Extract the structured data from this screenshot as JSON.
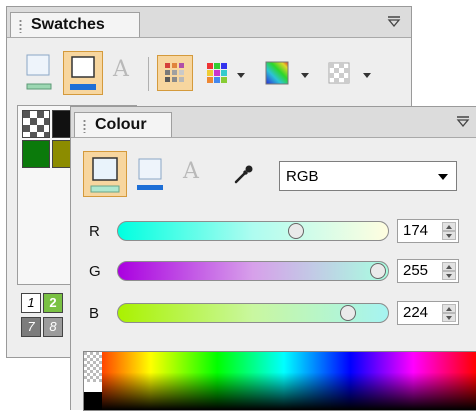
{
  "swatches_panel": {
    "title": "Swatches",
    "numbered_swatches": [
      "1",
      "2",
      "7",
      "8"
    ]
  },
  "colour_panel": {
    "title": "Colour",
    "model_select": {
      "value": "RGB"
    },
    "channels": [
      {
        "label": "R",
        "value": "174",
        "level": 0.68
      },
      {
        "label": "G",
        "value": "255",
        "level": 1.0
      },
      {
        "label": "B",
        "value": "224",
        "level": 0.88
      }
    ]
  },
  "icons": {
    "fill_stroke": "fill-stroke-icon",
    "text_color": "text-color-icon",
    "grid_view": "grid-view-icon",
    "gradient": "gradient-icon",
    "pattern": "pattern-icon",
    "eyedropper": "eyedropper-icon",
    "panel_menu": "panel-menu-icon"
  },
  "colors": {
    "selected_bg": "#f7d69f",
    "selected_border": "#d49a3c",
    "stroke_blue": "#1e6fd6",
    "dark_green": "#0b7a0b",
    "olive": "#8c8c00"
  }
}
